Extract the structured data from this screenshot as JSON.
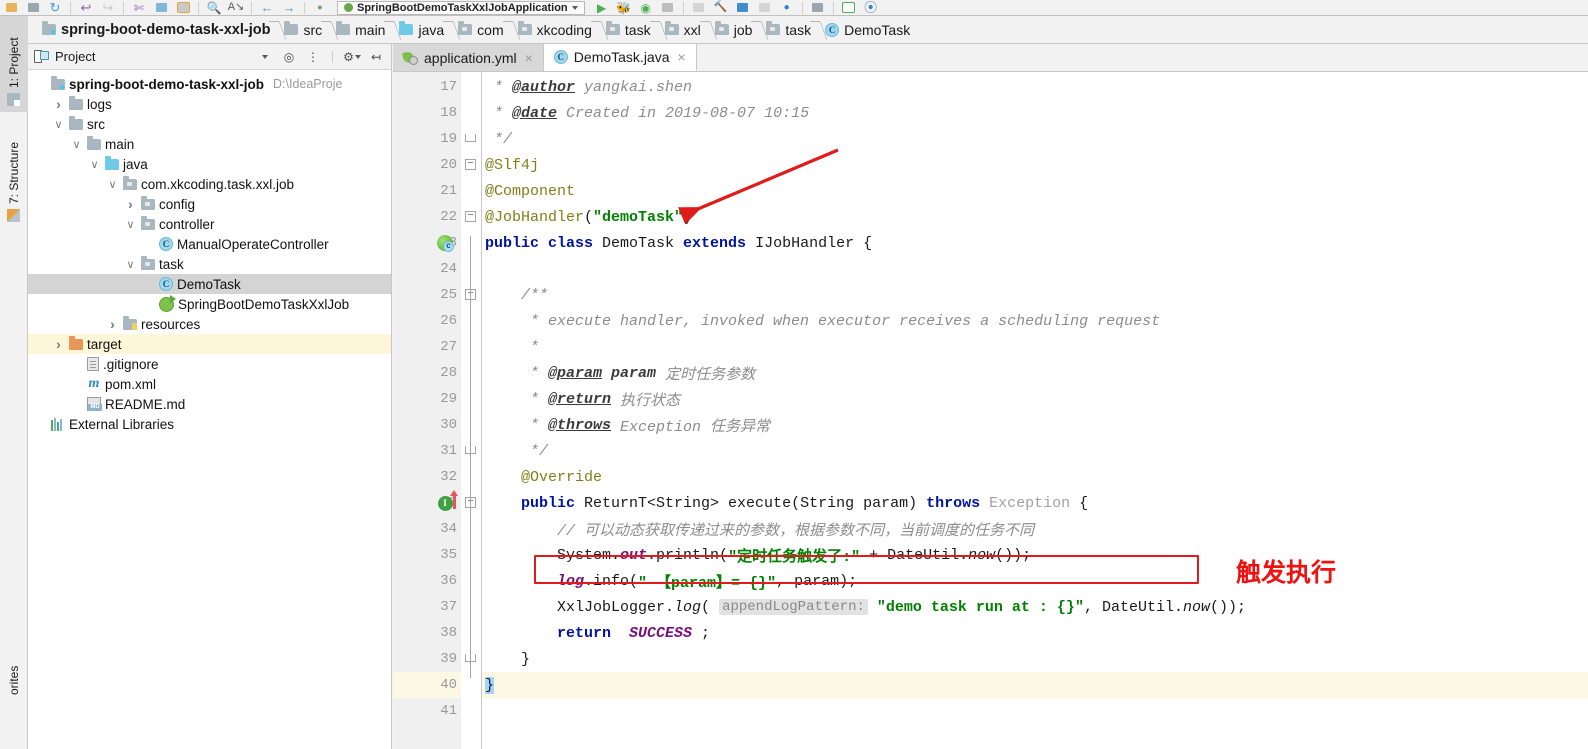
{
  "window": {
    "toolbar": {
      "run_config_label": "SpringBootDemoTaskXxlJobApplication",
      "icons": [
        "open-folder-icon",
        "save-all-icon",
        "sync-icon",
        "undo-icon",
        "redo-icon",
        "cut-icon",
        "copy-icon",
        "paste-icon",
        "find-icon",
        "replace-icon",
        "back-icon",
        "run-icon",
        "debug-icon",
        "coverage-icon",
        "stop-icon",
        "build-icon",
        "hammer-icon",
        "layout-icon",
        "profiler-icon",
        "bullet-icon",
        "save-icon",
        "terminal-icon",
        "help-icon"
      ]
    }
  },
  "breadcrumb": {
    "items": [
      {
        "label": "spring-boot-demo-task-xxl-job",
        "icon": "module-folder-icon",
        "bold": true
      },
      {
        "label": "src",
        "icon": "folder-icon",
        "bold": false
      },
      {
        "label": "main",
        "icon": "folder-icon",
        "bold": false
      },
      {
        "label": "java",
        "icon": "source-folder-icon",
        "bold": false
      },
      {
        "label": "com",
        "icon": "package-icon",
        "bold": false
      },
      {
        "label": "xkcoding",
        "icon": "package-icon",
        "bold": false
      },
      {
        "label": "task",
        "icon": "package-icon",
        "bold": false
      },
      {
        "label": "xxl",
        "icon": "package-icon",
        "bold": false
      },
      {
        "label": "job",
        "icon": "package-icon",
        "bold": false
      },
      {
        "label": "task",
        "icon": "package-icon",
        "bold": false
      },
      {
        "label": "DemoTask",
        "icon": "class-icon",
        "bold": false
      }
    ]
  },
  "left_tool_tabs": [
    {
      "label": "1: Project",
      "icon": "project-icon",
      "active": true
    },
    {
      "label": "7: Structure",
      "icon": "structure-icon",
      "active": false
    },
    {
      "label": "orites",
      "icon": "favorites-icon",
      "active": false
    }
  ],
  "project_panel": {
    "title": "Project",
    "toolbar_icons": [
      "select-opened-file-icon",
      "collapse-all-icon",
      "settings-gear-icon",
      "hide-panel-icon"
    ],
    "tree": [
      {
        "depth": 0,
        "twist": "none",
        "icon": "module-folder-icon",
        "label": "spring-boot-demo-task-xxl-job",
        "bold": true,
        "suffix": "D:\\IdeaProje",
        "state": "normal"
      },
      {
        "depth": 1,
        "twist": "right",
        "icon": "folder-icon",
        "label": "logs",
        "bold": false,
        "suffix": "",
        "state": "normal"
      },
      {
        "depth": 1,
        "twist": "down",
        "icon": "folder-icon",
        "label": "src",
        "bold": false,
        "suffix": "",
        "state": "normal"
      },
      {
        "depth": 2,
        "twist": "down",
        "icon": "folder-icon",
        "label": "main",
        "bold": false,
        "suffix": "",
        "state": "normal"
      },
      {
        "depth": 3,
        "twist": "down",
        "icon": "source-folder-icon",
        "label": "java",
        "bold": false,
        "suffix": "",
        "state": "normal"
      },
      {
        "depth": 4,
        "twist": "down",
        "icon": "package-icon",
        "label": "com.xkcoding.task.xxl.job",
        "bold": false,
        "suffix": "",
        "state": "normal"
      },
      {
        "depth": 5,
        "twist": "right",
        "icon": "package-icon",
        "label": "config",
        "bold": false,
        "suffix": "",
        "state": "normal"
      },
      {
        "depth": 5,
        "twist": "down",
        "icon": "package-icon",
        "label": "controller",
        "bold": false,
        "suffix": "",
        "state": "normal"
      },
      {
        "depth": 6,
        "twist": "none",
        "icon": "class-icon",
        "label": "ManualOperateController",
        "bold": false,
        "suffix": "",
        "state": "normal"
      },
      {
        "depth": 5,
        "twist": "down",
        "icon": "package-icon",
        "label": "task",
        "bold": false,
        "suffix": "",
        "state": "normal"
      },
      {
        "depth": 6,
        "twist": "none",
        "icon": "class-icon",
        "label": "DemoTask",
        "bold": false,
        "suffix": "",
        "state": "selected"
      },
      {
        "depth": 6,
        "twist": "none",
        "icon": "spring-app-icon",
        "label": "SpringBootDemoTaskXxlJob",
        "bold": false,
        "suffix": "",
        "state": "normal"
      },
      {
        "depth": 4,
        "twist": "right",
        "icon": "resource-folder-icon",
        "label": "resources",
        "bold": false,
        "suffix": "",
        "state": "normal"
      },
      {
        "depth": 1,
        "twist": "right",
        "icon": "target-folder-icon",
        "label": "target",
        "bold": false,
        "suffix": "",
        "state": "highlighted"
      },
      {
        "depth": 2,
        "twist": "none",
        "icon": "text-file-icon",
        "label": ".gitignore",
        "bold": false,
        "suffix": "",
        "state": "normal"
      },
      {
        "depth": 2,
        "twist": "none",
        "icon": "maven-icon",
        "label": "pom.xml",
        "bold": false,
        "suffix": "",
        "state": "normal"
      },
      {
        "depth": 2,
        "twist": "none",
        "icon": "markdown-icon",
        "label": "README.md",
        "bold": false,
        "suffix": "",
        "state": "normal"
      },
      {
        "depth": 0,
        "twist": "none",
        "icon": "library-icon",
        "label": "External Libraries",
        "bold": false,
        "suffix": "",
        "state": "normal"
      }
    ]
  },
  "editor": {
    "tabs": [
      {
        "label": "application.yml",
        "icon": "yaml-icon",
        "active": false,
        "close": "×"
      },
      {
        "label": "DemoTask.java",
        "icon": "class-icon",
        "active": true,
        "close": "×"
      }
    ],
    "first_line_number": 17,
    "caret_line": 40,
    "lines": [
      {
        "n": 17,
        "gutter_icon": "",
        "fold": "",
        "tokens": [
          {
            "t": " * ",
            "c": "cmt"
          },
          {
            "t": "@author",
            "c": "doctag"
          },
          {
            "t": " yangkai.shen",
            "c": "cmt"
          }
        ]
      },
      {
        "n": 18,
        "gutter_icon": "",
        "fold": "",
        "tokens": [
          {
            "t": " * ",
            "c": "cmt"
          },
          {
            "t": "@date",
            "c": "doctag"
          },
          {
            "t": " Created in 2019-08-07 10:15",
            "c": "cmt"
          }
        ]
      },
      {
        "n": 19,
        "gutter_icon": "",
        "fold": "end",
        "tokens": [
          {
            "t": " */",
            "c": "cmt"
          }
        ]
      },
      {
        "n": 20,
        "gutter_icon": "",
        "fold": "start",
        "tokens": [
          {
            "t": "@Slf4j",
            "c": "anno"
          }
        ]
      },
      {
        "n": 21,
        "gutter_icon": "",
        "fold": "",
        "tokens": [
          {
            "t": "@Component",
            "c": "anno"
          }
        ]
      },
      {
        "n": 22,
        "gutter_icon": "",
        "fold": "start2",
        "tokens": [
          {
            "t": "@JobHandler",
            "c": "anno"
          },
          {
            "t": "(",
            "c": "cls"
          },
          {
            "t": "\"demoTask\"",
            "c": "str"
          },
          {
            "t": ")",
            "c": "cls"
          }
        ]
      },
      {
        "n": 23,
        "gutter_icon": "spring-bean-icon",
        "fold": "",
        "tokens": [
          {
            "t": "public class ",
            "c": "kw"
          },
          {
            "t": "DemoTask ",
            "c": "cls"
          },
          {
            "t": "extends ",
            "c": "kw"
          },
          {
            "t": "IJobHandler ",
            "c": "cls"
          },
          {
            "t": "{",
            "c": "cls"
          }
        ]
      },
      {
        "n": 24,
        "gutter_icon": "",
        "fold": "",
        "tokens": []
      },
      {
        "n": 25,
        "gutter_icon": "",
        "fold": "start",
        "tokens": [
          {
            "t": "    /**",
            "c": "cmt"
          }
        ]
      },
      {
        "n": 26,
        "gutter_icon": "",
        "fold": "",
        "tokens": [
          {
            "t": "     * execute handler, invoked when executor receives a scheduling request",
            "c": "cmt"
          }
        ]
      },
      {
        "n": 27,
        "gutter_icon": "",
        "fold": "",
        "tokens": [
          {
            "t": "     *",
            "c": "cmt"
          }
        ]
      },
      {
        "n": 28,
        "gutter_icon": "",
        "fold": "",
        "tokens": [
          {
            "t": "     * ",
            "c": "cmt"
          },
          {
            "t": "@param",
            "c": "doctag"
          },
          {
            "t": " ",
            "c": "cmt"
          },
          {
            "t": "param",
            "c": "doctagb"
          },
          {
            "t": " 定时任务参数",
            "c": "cmt"
          }
        ]
      },
      {
        "n": 29,
        "gutter_icon": "",
        "fold": "",
        "tokens": [
          {
            "t": "     * ",
            "c": "cmt"
          },
          {
            "t": "@return",
            "c": "doctag"
          },
          {
            "t": " 执行状态",
            "c": "cmt"
          }
        ]
      },
      {
        "n": 30,
        "gutter_icon": "",
        "fold": "",
        "tokens": [
          {
            "t": "     * ",
            "c": "cmt"
          },
          {
            "t": "@throws",
            "c": "doctag"
          },
          {
            "t": " Exception 任务异常",
            "c": "cmt"
          }
        ]
      },
      {
        "n": 31,
        "gutter_icon": "",
        "fold": "end",
        "tokens": [
          {
            "t": "     */",
            "c": "cmt"
          }
        ]
      },
      {
        "n": 32,
        "gutter_icon": "",
        "fold": "",
        "tokens": [
          {
            "t": "    @Override",
            "c": "anno"
          }
        ]
      },
      {
        "n": 33,
        "gutter_icon": "override-icon",
        "fold": "start",
        "tokens": [
          {
            "t": "    public ",
            "c": "kw"
          },
          {
            "t": "ReturnT<String> execute(String param) ",
            "c": "cls"
          },
          {
            "t": "throws ",
            "c": "kw"
          },
          {
            "t": "Exception ",
            "c": "grey"
          },
          {
            "t": "{",
            "c": "cls"
          }
        ]
      },
      {
        "n": 34,
        "gutter_icon": "",
        "fold": "",
        "tokens": [
          {
            "t": "        // 可以动态获取传递过来的参数，根据参数不同，当前调度的任务不同",
            "c": "cmt"
          }
        ]
      },
      {
        "n": 35,
        "gutter_icon": "",
        "fold": "",
        "tokens": [
          {
            "t": "        System.",
            "c": "cls"
          },
          {
            "t": "out",
            "c": "fld"
          },
          {
            "t": ".println(",
            "c": "cls"
          },
          {
            "t": "\"定时任务触发了:\"",
            "c": "str"
          },
          {
            "t": " + DateUtil.",
            "c": "cls"
          },
          {
            "t": "now",
            "c": "itl"
          },
          {
            "t": "());",
            "c": "cls"
          }
        ]
      },
      {
        "n": 36,
        "gutter_icon": "",
        "fold": "",
        "tokens": [
          {
            "t": "        ",
            "c": "cls"
          },
          {
            "t": "log",
            "c": "fld"
          },
          {
            "t": ".info(",
            "c": "cls"
          },
          {
            "t": "\" 【param】= {}\"",
            "c": "str"
          },
          {
            "t": ", param);",
            "c": "cls"
          }
        ]
      },
      {
        "n": 37,
        "gutter_icon": "",
        "fold": "",
        "tokens": [
          {
            "t": "        XxlJobLogger.",
            "c": "cls"
          },
          {
            "t": "log",
            "c": "itl"
          },
          {
            "t": "( ",
            "c": "cls"
          },
          {
            "t": "appendLogPattern:",
            "c": "hint"
          },
          {
            "t": " ",
            "c": "cls"
          },
          {
            "t": "\"demo task run at : {}\"",
            "c": "str"
          },
          {
            "t": ", DateUtil.",
            "c": "cls"
          },
          {
            "t": "now",
            "c": "itl"
          },
          {
            "t": "());",
            "c": "cls"
          }
        ]
      },
      {
        "n": 38,
        "gutter_icon": "",
        "fold": "",
        "tokens": [
          {
            "t": "        return ",
            "c": "kw"
          },
          {
            "t": " SUCCESS ",
            "c": "stat"
          },
          {
            "t": ";",
            "c": "cls"
          }
        ]
      },
      {
        "n": 39,
        "gutter_icon": "",
        "fold": "end",
        "tokens": [
          {
            "t": "    }",
            "c": "cls"
          }
        ]
      },
      {
        "n": 40,
        "gutter_icon": "",
        "fold": "",
        "tokens": [
          {
            "t": "}",
            "c": "selblock"
          }
        ]
      },
      {
        "n": 41,
        "gutter_icon": "",
        "fold": "",
        "tokens": []
      }
    ]
  },
  "annotations": {
    "arrow_color": "#e01b1b",
    "box_color": "#e01b1b",
    "label_color": "#f01010",
    "callout_text": "触发执行",
    "highlight_target_line": 35,
    "arrow_target": "@JobHandler(\"demoTask\")"
  }
}
